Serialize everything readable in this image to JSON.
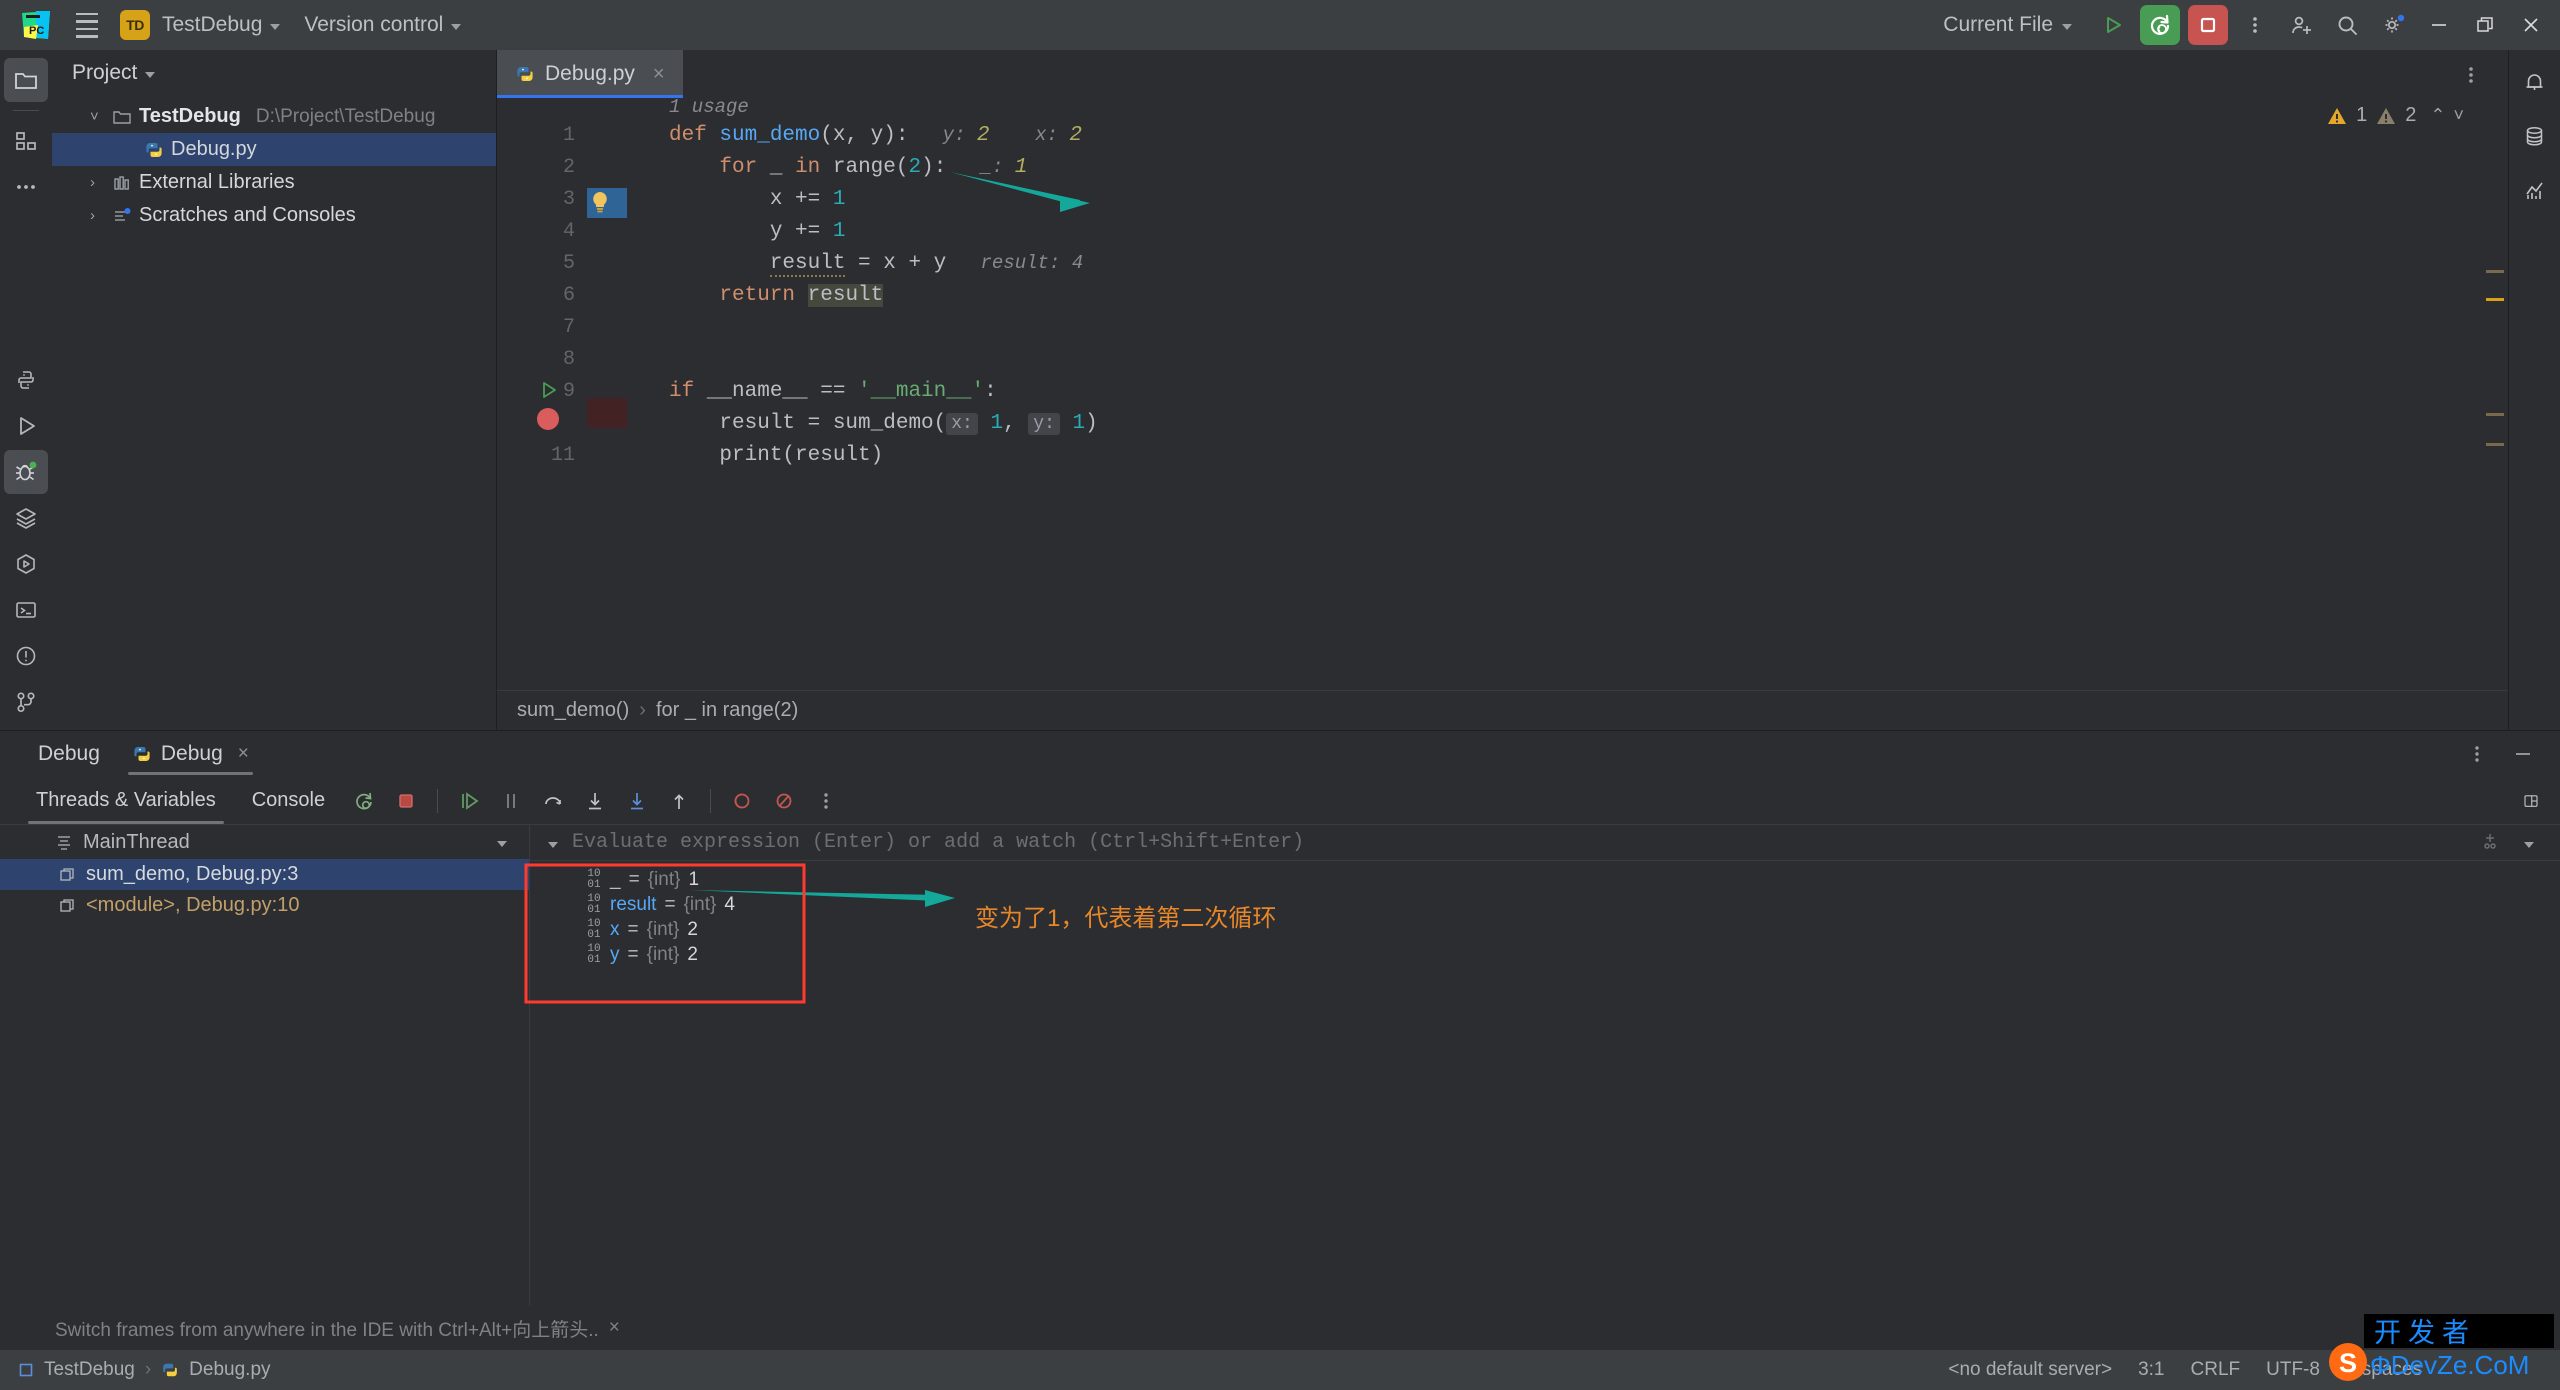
{
  "titlebar": {
    "menu_icon": "hamburger-icon",
    "project_badge": "TD",
    "project_name": "TestDebug",
    "version_control": "Version control",
    "run_config": "Current File",
    "run_icon": "run-icon",
    "debug_icon": "debug-rerun-icon",
    "stop_icon": "stop-icon",
    "more_icon": "more-vertical-icon",
    "account_icon": "add-user-icon",
    "search_icon": "search-icon",
    "settings_icon": "gear-icon",
    "minimize_icon": "minimize-icon",
    "maximize_icon": "restore-icon",
    "close_icon": "close-icon"
  },
  "left_rail": {
    "items": [
      {
        "name": "project-tool-window",
        "icon": "folder-icon",
        "active": true
      },
      {
        "name": "structure-tool-window",
        "icon": "structure-icon",
        "active": false
      },
      {
        "name": "more-tool-windows",
        "icon": "ellipsis-icon",
        "active": false
      }
    ],
    "bottom_items": [
      {
        "name": "python-packages",
        "icon": "python-icon"
      },
      {
        "name": "run-tool-window",
        "icon": "play-icon"
      },
      {
        "name": "debug-tool-window",
        "icon": "bug-icon",
        "active": true
      },
      {
        "name": "services-tool-window",
        "icon": "layers-icon"
      },
      {
        "name": "python-console",
        "icon": "hex-play-icon"
      },
      {
        "name": "terminal-tool-window",
        "icon": "terminal-icon"
      },
      {
        "name": "problems-tool-window",
        "icon": "warning-circle-icon"
      },
      {
        "name": "version-control-tool-window",
        "icon": "branch-icon"
      }
    ]
  },
  "right_rail": {
    "items": [
      {
        "name": "notifications",
        "icon": "bell-icon"
      },
      {
        "name": "database",
        "icon": "database-icon"
      },
      {
        "name": "profiler",
        "icon": "chart-icon"
      }
    ]
  },
  "project_panel": {
    "title": "Project",
    "tree": [
      {
        "indent": 0,
        "arrow": "˅",
        "icon": "folder-icon",
        "label": "TestDebug",
        "bold": true,
        "path": "D:\\Project\\TestDebug",
        "selected": false
      },
      {
        "indent": 1,
        "arrow": "",
        "icon": "python-file-icon",
        "label": "Debug.py",
        "bold": false,
        "path": "",
        "selected": true
      },
      {
        "indent": 0,
        "arrow": "›",
        "icon": "library-icon",
        "label": "External Libraries",
        "bold": false,
        "path": "",
        "selected": false
      },
      {
        "indent": 0,
        "arrow": "›",
        "icon": "scratches-icon",
        "label": "Scratches and Consoles",
        "bold": false,
        "path": "",
        "selected": false
      }
    ]
  },
  "editor": {
    "tab": {
      "label": "Debug.py",
      "icon": "python-file-icon",
      "close": "×"
    },
    "options_icon": "more-vertical-icon",
    "usage_hint": "1 usage",
    "inspections": {
      "warning_count": "1",
      "weak_warning_count": "2",
      "up": "⌃",
      "down": "˅"
    },
    "lines": [
      {
        "no": "1",
        "gutter": "",
        "segments": [
          {
            "t": "def ",
            "c": "kw"
          },
          {
            "t": "sum_demo",
            "c": "fn"
          },
          {
            "t": "(x, y):",
            "c": "txt"
          },
          {
            "t": "   y: ",
            "c": "hint"
          },
          {
            "t": "2",
            "c": "hintnum"
          },
          {
            "t": "    x: ",
            "c": "hint"
          },
          {
            "t": "2",
            "c": "hintnum"
          }
        ]
      },
      {
        "no": "2",
        "gutter": "",
        "segments": [
          {
            "t": "    ",
            "c": "txt"
          },
          {
            "t": "for ",
            "c": "kw"
          },
          {
            "t": "_ ",
            "c": "txt"
          },
          {
            "t": "in ",
            "c": "kw"
          },
          {
            "t": "range(",
            "c": "txt"
          },
          {
            "t": "2",
            "c": "num"
          },
          {
            "t": "):",
            "c": "txt"
          },
          {
            "t": "   _: ",
            "c": "hint"
          },
          {
            "t": "1",
            "c": "hintnum"
          }
        ]
      },
      {
        "no": "3",
        "gutter": "bulb",
        "highlight": "current",
        "segments": [
          {
            "t": "        x += ",
            "c": "txt"
          },
          {
            "t": "1",
            "c": "num"
          }
        ]
      },
      {
        "no": "4",
        "gutter": "",
        "segments": [
          {
            "t": "        y += ",
            "c": "txt"
          },
          {
            "t": "1",
            "c": "num"
          }
        ]
      },
      {
        "no": "5",
        "gutter": "",
        "segments": [
          {
            "t": "        ",
            "c": "txt"
          },
          {
            "t": "result",
            "c": "squig"
          },
          {
            "t": " = x + y",
            "c": "txt"
          },
          {
            "t": "   result: ",
            "c": "hint"
          },
          {
            "t": "4",
            "c": "hint"
          }
        ]
      },
      {
        "no": "6",
        "gutter": "",
        "segments": [
          {
            "t": "    ",
            "c": "txt"
          },
          {
            "t": "return ",
            "c": "kw"
          },
          {
            "t": "result",
            "c": "hlword"
          }
        ]
      },
      {
        "no": "7",
        "gutter": "",
        "segments": []
      },
      {
        "no": "8",
        "gutter": "",
        "segments": []
      },
      {
        "no": "9",
        "gutter": "run",
        "segments": [
          {
            "t": "if ",
            "c": "kw"
          },
          {
            "t": "__name__ == ",
            "c": "txt"
          },
          {
            "t": "'__main__'",
            "c": "str"
          },
          {
            "t": ":",
            "c": "txt"
          }
        ]
      },
      {
        "no": "10",
        "gutter": "breakpoint",
        "highlight": "breakpoint",
        "hide_number": true,
        "segments": [
          {
            "t": "    result = ",
            "c": "txt"
          },
          {
            "t": "sum_demo",
            "c": "txt"
          },
          {
            "t": "(",
            "c": "txt"
          },
          {
            "t": "x:",
            "c": "pbadge"
          },
          {
            "t": " ",
            "c": "txt"
          },
          {
            "t": "1",
            "c": "num"
          },
          {
            "t": ", ",
            "c": "txt"
          },
          {
            "t": "y:",
            "c": "pbadge"
          },
          {
            "t": " ",
            "c": "txt"
          },
          {
            "t": "1",
            "c": "num"
          },
          {
            "t": ")",
            "c": "txt"
          }
        ]
      },
      {
        "no": "11",
        "gutter": "",
        "segments": [
          {
            "t": "    print(result)",
            "c": "txt"
          }
        ]
      }
    ],
    "breadcrumb": [
      "sum_demo()",
      "for _ in range(2)"
    ]
  },
  "debug_window": {
    "title": "Debug",
    "session_tab": {
      "label": "Debug",
      "icon": "python-icon",
      "close": "×"
    },
    "options_icon": "more-vertical-icon",
    "hide_icon": "minimize-icon",
    "sub_tabs": [
      {
        "label": "Threads & Variables",
        "active": true
      },
      {
        "label": "Console",
        "active": false
      }
    ],
    "toolbar_icons": [
      {
        "name": "rerun-debug-icon"
      },
      {
        "name": "stop-icon"
      },
      {
        "name": "resume-program-icon"
      },
      {
        "name": "pause-program-icon"
      },
      {
        "name": "step-over-icon"
      },
      {
        "name": "step-into-icon"
      },
      {
        "name": "force-step-into-icon"
      },
      {
        "name": "step-out-icon"
      },
      {
        "name": "view-breakpoints-icon"
      },
      {
        "name": "mute-breakpoints-icon"
      },
      {
        "name": "more-options-icon"
      }
    ],
    "layout_icon": "layout-settings-icon",
    "thread": {
      "label": "MainThread",
      "icon": "thread-icon"
    },
    "frames": [
      {
        "label": "sum_demo, Debug.py:3",
        "fn": "sum_demo",
        "loc": ", Debug.py:3",
        "selected": true
      },
      {
        "label": "<module>, Debug.py:10",
        "fn": "<module>",
        "loc": ", Debug.py:10",
        "selected": false
      }
    ],
    "evaluate_placeholder": "Evaluate expression (Enter) or add a watch (Ctrl+Shift+Enter)",
    "variables": [
      {
        "name": "_",
        "type": "{int}",
        "value": "1",
        "icon": "binary-icon"
      },
      {
        "name": "result",
        "type": "{int}",
        "value": "4",
        "icon": "binary-icon"
      },
      {
        "name": "x",
        "type": "{int}",
        "value": "2",
        "icon": "binary-icon"
      },
      {
        "name": "y",
        "type": "{int}",
        "value": "2",
        "icon": "binary-icon"
      }
    ],
    "status_hint": "Switch frames from anywhere in the IDE with Ctrl+Alt+向上箭头..",
    "status_hint_close": "×"
  },
  "annotations": {
    "arrow_color": "#14a89a",
    "box_color": "#ff3b30",
    "text_color": "#e8862a",
    "note": "变为了1，代表着第二次循环"
  },
  "statusbar": {
    "breadcrumb": [
      "TestDebug",
      "Debug.py"
    ],
    "server": "<no default server>",
    "caret": "3:1",
    "line_ending": "CRLF",
    "encoding": "UTF-8",
    "indent": "4 spaces"
  },
  "watermark": {
    "cn": "开发者",
    "en": "DevZe.CoM"
  }
}
